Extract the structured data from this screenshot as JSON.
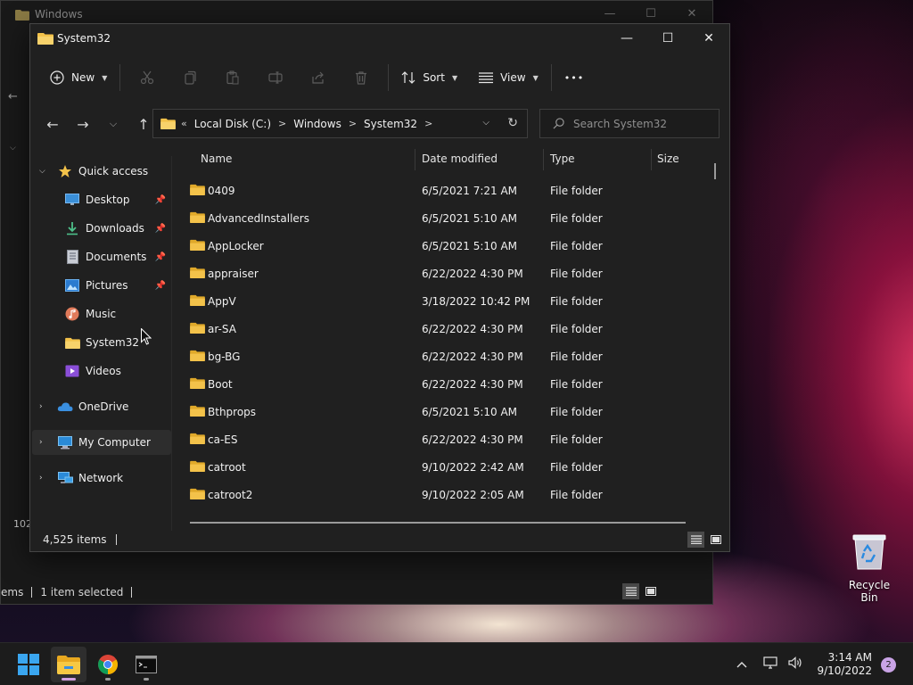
{
  "back_window": {
    "title": "Windows",
    "status_count": "ems",
    "status_selected": "1 item selected",
    "left_number": "102"
  },
  "window": {
    "title": "System32",
    "controls": {
      "minimize": "—",
      "maximize": "☐",
      "close": "✕"
    }
  },
  "toolbar": {
    "new_label": "New",
    "sort_label": "Sort",
    "view_label": "View",
    "more_label": "•••"
  },
  "address": {
    "overflow": "«",
    "crumbs": [
      "Local Disk (C:)",
      "Windows",
      "System32"
    ]
  },
  "search": {
    "placeholder": "Search System32"
  },
  "sidebar": {
    "quick_access": "Quick access",
    "items": [
      {
        "label": "Desktop",
        "pinned": true
      },
      {
        "label": "Downloads",
        "pinned": true
      },
      {
        "label": "Documents",
        "pinned": true
      },
      {
        "label": "Pictures",
        "pinned": true
      },
      {
        "label": "Music",
        "pinned": false
      },
      {
        "label": "System32",
        "pinned": false
      },
      {
        "label": "Videos",
        "pinned": false
      }
    ],
    "onedrive": "OneDrive",
    "my_computer": "My Computer",
    "network": "Network"
  },
  "columns": {
    "name": "Name",
    "date": "Date modified",
    "type": "Type",
    "size": "Size"
  },
  "files": [
    {
      "name": "0409",
      "date": "6/5/2021 7:21 AM",
      "type": "File folder"
    },
    {
      "name": "AdvancedInstallers",
      "date": "6/5/2021 5:10 AM",
      "type": "File folder"
    },
    {
      "name": "AppLocker",
      "date": "6/5/2021 5:10 AM",
      "type": "File folder"
    },
    {
      "name": "appraiser",
      "date": "6/22/2022 4:30 PM",
      "type": "File folder"
    },
    {
      "name": "AppV",
      "date": "3/18/2022 10:42 PM",
      "type": "File folder"
    },
    {
      "name": "ar-SA",
      "date": "6/22/2022 4:30 PM",
      "type": "File folder"
    },
    {
      "name": "bg-BG",
      "date": "6/22/2022 4:30 PM",
      "type": "File folder"
    },
    {
      "name": "Boot",
      "date": "6/22/2022 4:30 PM",
      "type": "File folder"
    },
    {
      "name": "Bthprops",
      "date": "6/5/2021 5:10 AM",
      "type": "File folder"
    },
    {
      "name": "ca-ES",
      "date": "6/22/2022 4:30 PM",
      "type": "File folder"
    },
    {
      "name": "catroot",
      "date": "9/10/2022 2:42 AM",
      "type": "File folder"
    },
    {
      "name": "catroot2",
      "date": "9/10/2022 2:05 AM",
      "type": "File folder"
    }
  ],
  "status": {
    "count": "4,525 items"
  },
  "desktop": {
    "recycle_bin": "Recycle Bin"
  },
  "taskbar": {
    "time": "3:14 AM",
    "date": "9/10/2022",
    "notification_count": "2",
    "tray_chevron": "^"
  },
  "colors": {
    "folder": "#f3c24a",
    "accent": "#d0a0e0",
    "window_bg": "#202020"
  }
}
